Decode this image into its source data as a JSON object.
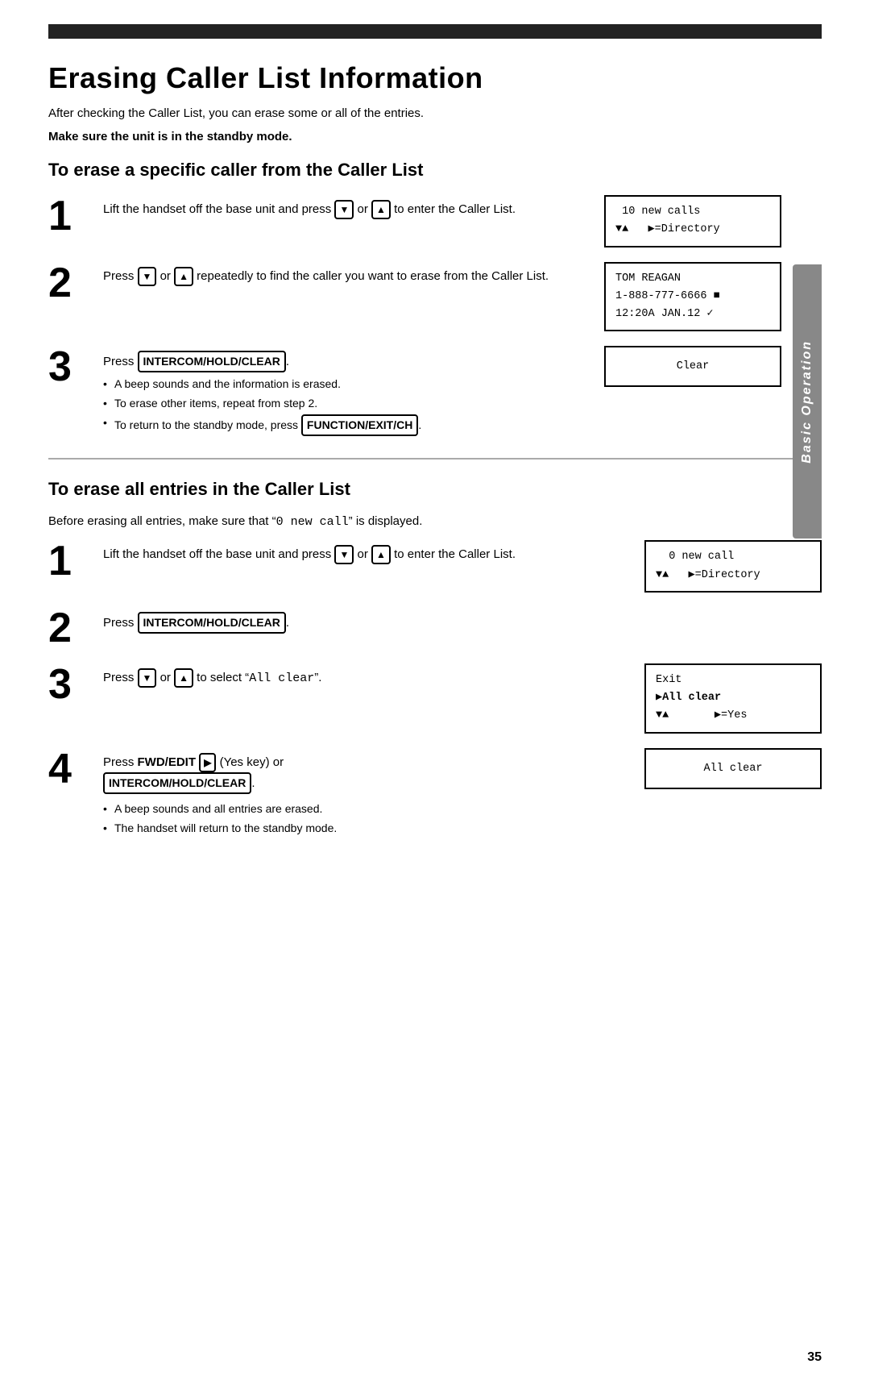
{
  "page": {
    "number": "35",
    "top_bar": true
  },
  "header": {
    "title": "Erasing Caller List Information",
    "intro": "After checking the Caller List, you can erase some or all of the entries.",
    "standby_note": "Make sure the unit is in the standby mode."
  },
  "section1": {
    "title": "To erase a specific caller from the Caller List",
    "steps": [
      {
        "number": "1",
        "text": "Lift the handset off the base unit and press",
        "text2": "or",
        "text3": "to enter the Caller List.",
        "keys": [
          "▼",
          "▲"
        ],
        "display": {
          "line1": " 10 new calls",
          "line2": "▼▲   ▶=Directory"
        }
      },
      {
        "number": "2",
        "text": "Press",
        "text2": "or",
        "text3": "repeatedly to find the caller you want to erase from the Caller List.",
        "keys": [
          "▼",
          "▲"
        ],
        "display": {
          "line1": "TOM REAGAN",
          "line2": "1-888-777-6666 ■",
          "line3": "12:20A JAN.12 ✓"
        }
      },
      {
        "number": "3",
        "text": "Press",
        "key": "INTERCOM/HOLD/CLEAR",
        "bullets": [
          "A beep sounds and the information is erased.",
          "To erase other items, repeat from step 2.",
          "To return to the standby mode, press"
        ],
        "last_key": "FUNCTION/EXIT/CH",
        "display": {
          "line1": "Clear"
        }
      }
    ]
  },
  "section2": {
    "title": "To erase all entries in the Caller List",
    "intro": "Before erasing all entries, make sure that \"0 new call\" is displayed.",
    "steps": [
      {
        "number": "1",
        "text": "Lift the handset off the base unit and press",
        "text2": "or",
        "text3": "to enter the Caller List.",
        "keys": [
          "▼",
          "▲"
        ],
        "display": {
          "line1": "  0 new call",
          "line2": "▼▲   ▶=Directory"
        }
      },
      {
        "number": "2",
        "text": "Press",
        "key": "INTERCOM/HOLD/CLEAR",
        "display": null
      },
      {
        "number": "3",
        "text": "Press",
        "text2": "or",
        "text3": "to select \"All clear\".",
        "keys": [
          "▼",
          "▲"
        ],
        "display": {
          "line1": "Exit",
          "line2": "▶All clear",
          "line3": "▼▲       ▶=Yes"
        }
      },
      {
        "number": "4",
        "text": "Press FWD/EDIT",
        "fwd_key": "▶",
        "text2": "(Yes key) or",
        "key": "INTERCOM/HOLD/CLEAR",
        "bullets": [
          "A beep sounds and all entries are erased.",
          "The handset will return to the standby mode."
        ],
        "display": {
          "line1": "All clear"
        }
      }
    ]
  },
  "side_tab": {
    "text": "Basic Operation"
  },
  "labels": {
    "intercom_key": "INTERCOM/HOLD/CLEAR",
    "function_key": "FUNCTION/EXIT/CH",
    "fwd_key": "FWD/EDIT"
  }
}
